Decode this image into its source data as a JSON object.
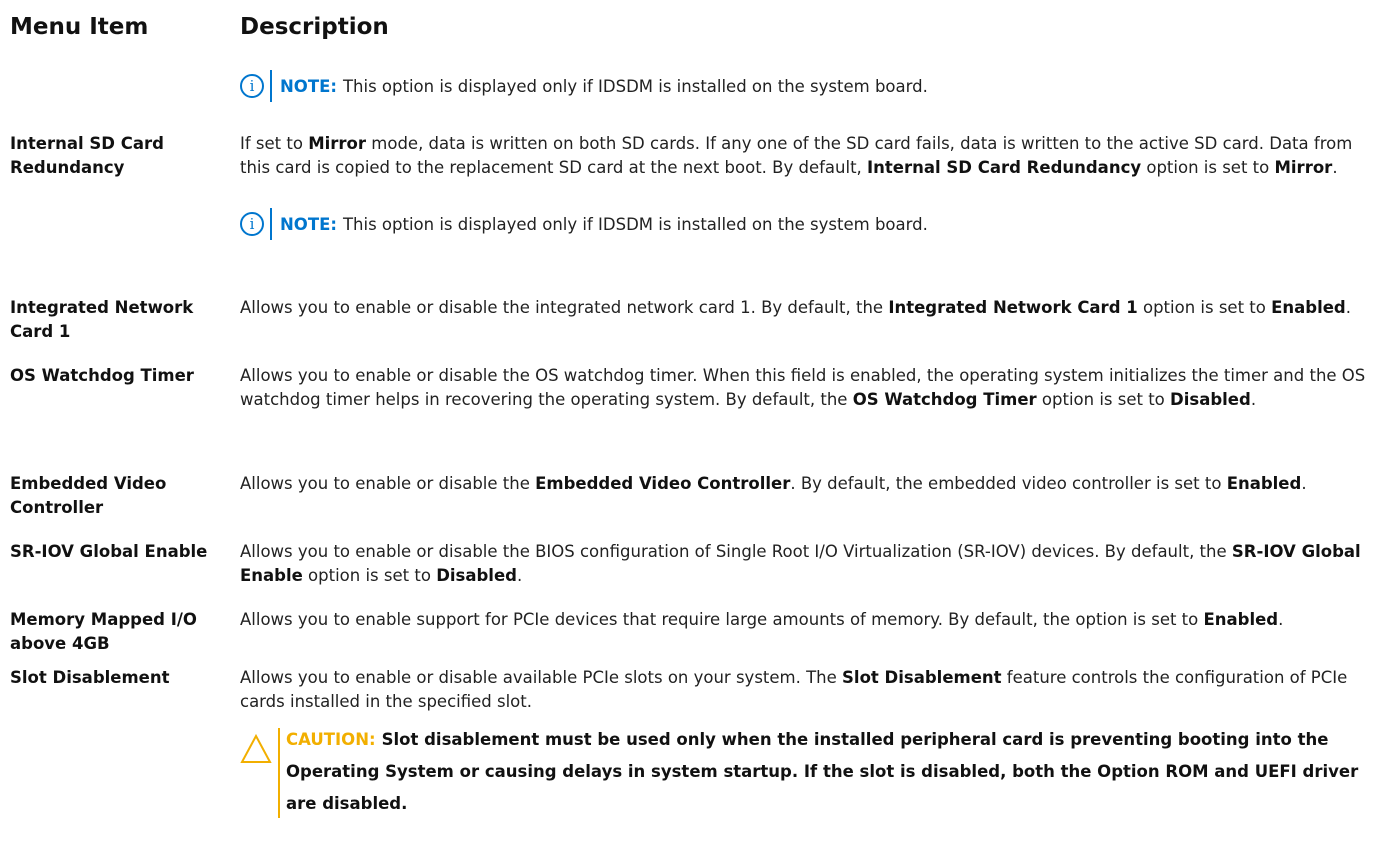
{
  "header": {
    "menu_item": "Menu Item",
    "description": "Description"
  },
  "note_label": "NOTE:",
  "rows": [
    {
      "id": "idsdm-note",
      "note": "This option is displayed only if IDSDM is installed on the system board."
    },
    {
      "id": "internal-sd-card-redundancy",
      "item": "Internal SD Card Redundancy",
      "desc": [
        {
          "t": "If set to "
        },
        {
          "b": "Mirror"
        },
        {
          "t": " mode, data is written on both SD cards. If any one of the SD card fails, data is written to the active SD card. Data from this card is copied to the replacement SD card at the next boot. By default, "
        },
        {
          "b": "Internal SD Card Redundancy"
        },
        {
          "t": " option is set to "
        },
        {
          "b": "Mirror"
        },
        {
          "t": "."
        }
      ],
      "note": "This option is displayed only if IDSDM is installed on the system board."
    },
    {
      "id": "integrated-network-card-1",
      "item": "Integrated Network Card 1",
      "desc": [
        {
          "t": "Allows you to enable or disable the integrated network card 1. By default, the "
        },
        {
          "b": "Integrated Network Card 1"
        },
        {
          "t": " option is set to "
        },
        {
          "b": "Enabled"
        },
        {
          "t": "."
        }
      ]
    },
    {
      "id": "os-watchdog-timer",
      "item": "OS Watchdog Timer",
      "desc": [
        {
          "t": "Allows you to enable or disable the OS watchdog timer. When this field is enabled, the operating system initializes the timer and the OS watchdog timer helps in recovering the operating system. By default, the "
        },
        {
          "b": "OS Watchdog Timer"
        },
        {
          "t": " option is set to "
        },
        {
          "b": "Disabled"
        },
        {
          "t": "."
        }
      ]
    },
    {
      "id": "embedded-video-controller",
      "item": "Embedded Video Controller",
      "desc": [
        {
          "t": "Allows you to enable or disable the "
        },
        {
          "b": "Embedded Video Controller"
        },
        {
          "t": ". By default, the embedded video controller is set to "
        },
        {
          "b": "Enabled"
        },
        {
          "t": "."
        }
      ]
    },
    {
      "id": "sr-iov-global-enable",
      "item": "SR-IOV Global Enable",
      "desc": [
        {
          "t": "Allows you to enable or disable the BIOS configuration of Single Root I/O Virtualization (SR-IOV) devices. By default, the "
        },
        {
          "b": "SR-IOV Global Enable"
        },
        {
          "t": " option is set to "
        },
        {
          "b": "Disabled"
        },
        {
          "t": "."
        }
      ]
    },
    {
      "id": "memory-mapped-io-above-4gb",
      "item": "Memory Mapped I/O above 4GB",
      "desc": [
        {
          "t": "Allows you to enable support for PCIe devices that require large amounts of memory. By default, the option is set to "
        },
        {
          "b": "Enabled"
        },
        {
          "t": "."
        }
      ]
    },
    {
      "id": "slot-disablement",
      "item": "Slot Disablement",
      "desc": [
        {
          "t": "Allows you to enable or disable available PCIe slots on your system. The "
        },
        {
          "b": "Slot Disablement"
        },
        {
          "t": " feature controls the configuration of PCIe cards installed in the specified slot."
        }
      ]
    }
  ],
  "caution": {
    "label": "CAUTION:",
    "text": "Slot disablement must be used only when the installed peripheral card is preventing booting into the Operating System or causing delays in system startup. If the slot is disabled, both the Option ROM and UEFI driver are disabled."
  },
  "colors": {
    "note_accent": "#0076ce",
    "caution_accent": "#f2af00",
    "text": "#222222"
  },
  "icons": {
    "note": "info-circle-icon",
    "caution": "warning-triangle-icon"
  }
}
